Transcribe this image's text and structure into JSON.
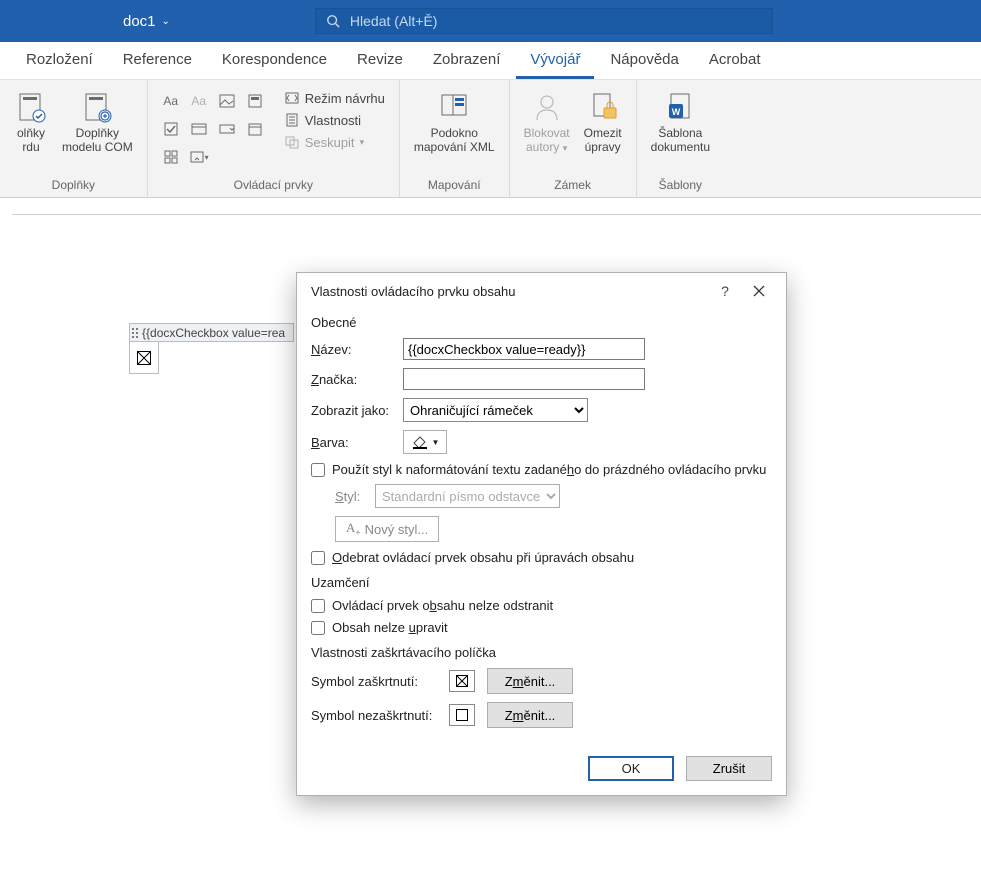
{
  "titlebar": {
    "docname": "doc1",
    "search_placeholder": "Hledat (Alt+Ě)"
  },
  "tabs": {
    "rozlozeni": "Rozložení",
    "reference": "Reference",
    "korespondence": "Korespondence",
    "revize": "Revize",
    "zobrazeni": "Zobrazení",
    "vyvojar": "Vývojář",
    "napoveda": "Nápověda",
    "acrobat": "Acrobat"
  },
  "ribbon": {
    "group_doplnky": "Doplňky",
    "btn_word_addins_l1": "olňky",
    "btn_word_addins_l2": "rdu",
    "btn_com_l1": "Doplňky",
    "btn_com_l2": "modelu COM",
    "group_ovladaci": "Ovládací prvky",
    "rezim_navrhu": "Režim návrhu",
    "vlastnosti": "Vlastnosti",
    "seskupit": "Seskupit",
    "group_mapovani": "Mapování",
    "podokno_l1": "Podokno",
    "podokno_l2": "mapování XML",
    "group_zamek": "Zámek",
    "blokovat_l1": "Blokovat",
    "blokovat_l2": "autory",
    "omezit_l1": "Omezit",
    "omezit_l2": "úpravy",
    "group_sablony": "Šablony",
    "sablona_l1": "Šablona",
    "sablona_l2": "dokumentu"
  },
  "page": {
    "tag_label": "{{docxCheckbox value=rea"
  },
  "dialog": {
    "title": "Vlastnosti ovládacího prvku obsahu",
    "section_obecne": "Obecné",
    "lbl_nazev": "Název:",
    "val_nazev": "{{docxCheckbox value=ready}}",
    "lbl_znacka": "Značka:",
    "val_znacka": "",
    "lbl_zobrazit": "Zobrazit jako:",
    "val_zobrazit": "Ohraničující rámeček",
    "lbl_barva": "Barva:",
    "chk_pouzit_styl": "Použít styl k naformátování textu zadaného do prázdného ovládacího prvku",
    "lbl_styl": "Styl:",
    "val_styl": "Standardní písmo odstavce",
    "btn_novy_styl": "Nový styl...",
    "chk_odebrat": "Odebrat ovládací prvek obsahu při úpravách obsahu",
    "section_uzamceni": "Uzamčení",
    "chk_nelze_odstranit": "Ovládací prvek obsahu nelze odstranit",
    "chk_nelze_upravit": "Obsah nelze upravit",
    "section_zaskrtavaci": "Vlastnosti zaškrtávacího políčka",
    "lbl_sym_zaskrtnuti": "Symbol zaškrtnutí:",
    "lbl_sym_nezaskrtnuti": "Symbol nezaškrtnutí:",
    "btn_zmenit": "Změnit...",
    "btn_ok": "OK",
    "btn_zrusit": "Zrušit"
  }
}
